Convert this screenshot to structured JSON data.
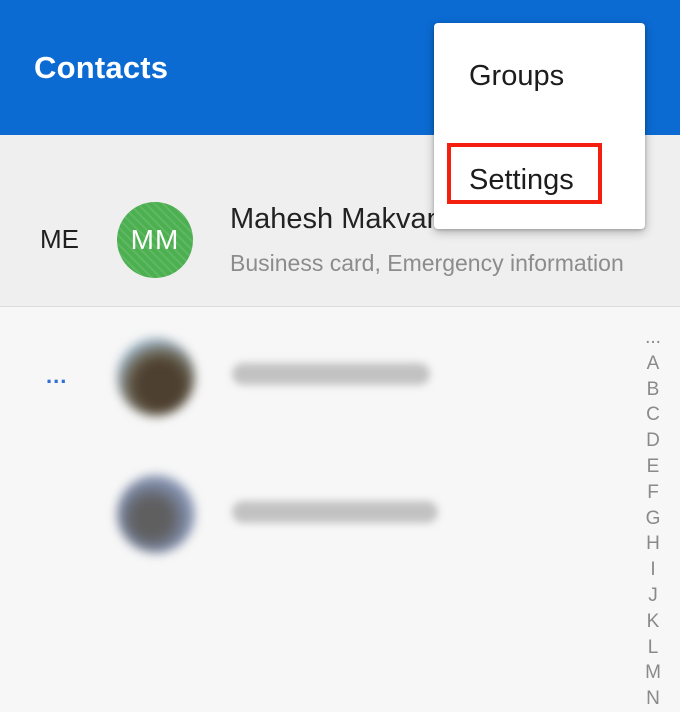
{
  "header": {
    "title": "Contacts"
  },
  "me_section": {
    "label": "ME",
    "avatar_initials": "MM",
    "avatar_color": "#4caf50",
    "name": "Mahesh Makvana",
    "subtitle": "Business card, Emergency information"
  },
  "more_section": {
    "label": "..."
  },
  "alphabet_index": [
    "...",
    "A",
    "B",
    "C",
    "D",
    "E",
    "F",
    "G",
    "H",
    "I",
    "J",
    "K",
    "L",
    "M",
    "N"
  ],
  "overflow_menu": {
    "items": [
      {
        "label": "Groups"
      },
      {
        "label": "Settings"
      }
    ]
  },
  "colors": {
    "header_bg": "#0b6bd3",
    "highlight": "#f51f10"
  }
}
